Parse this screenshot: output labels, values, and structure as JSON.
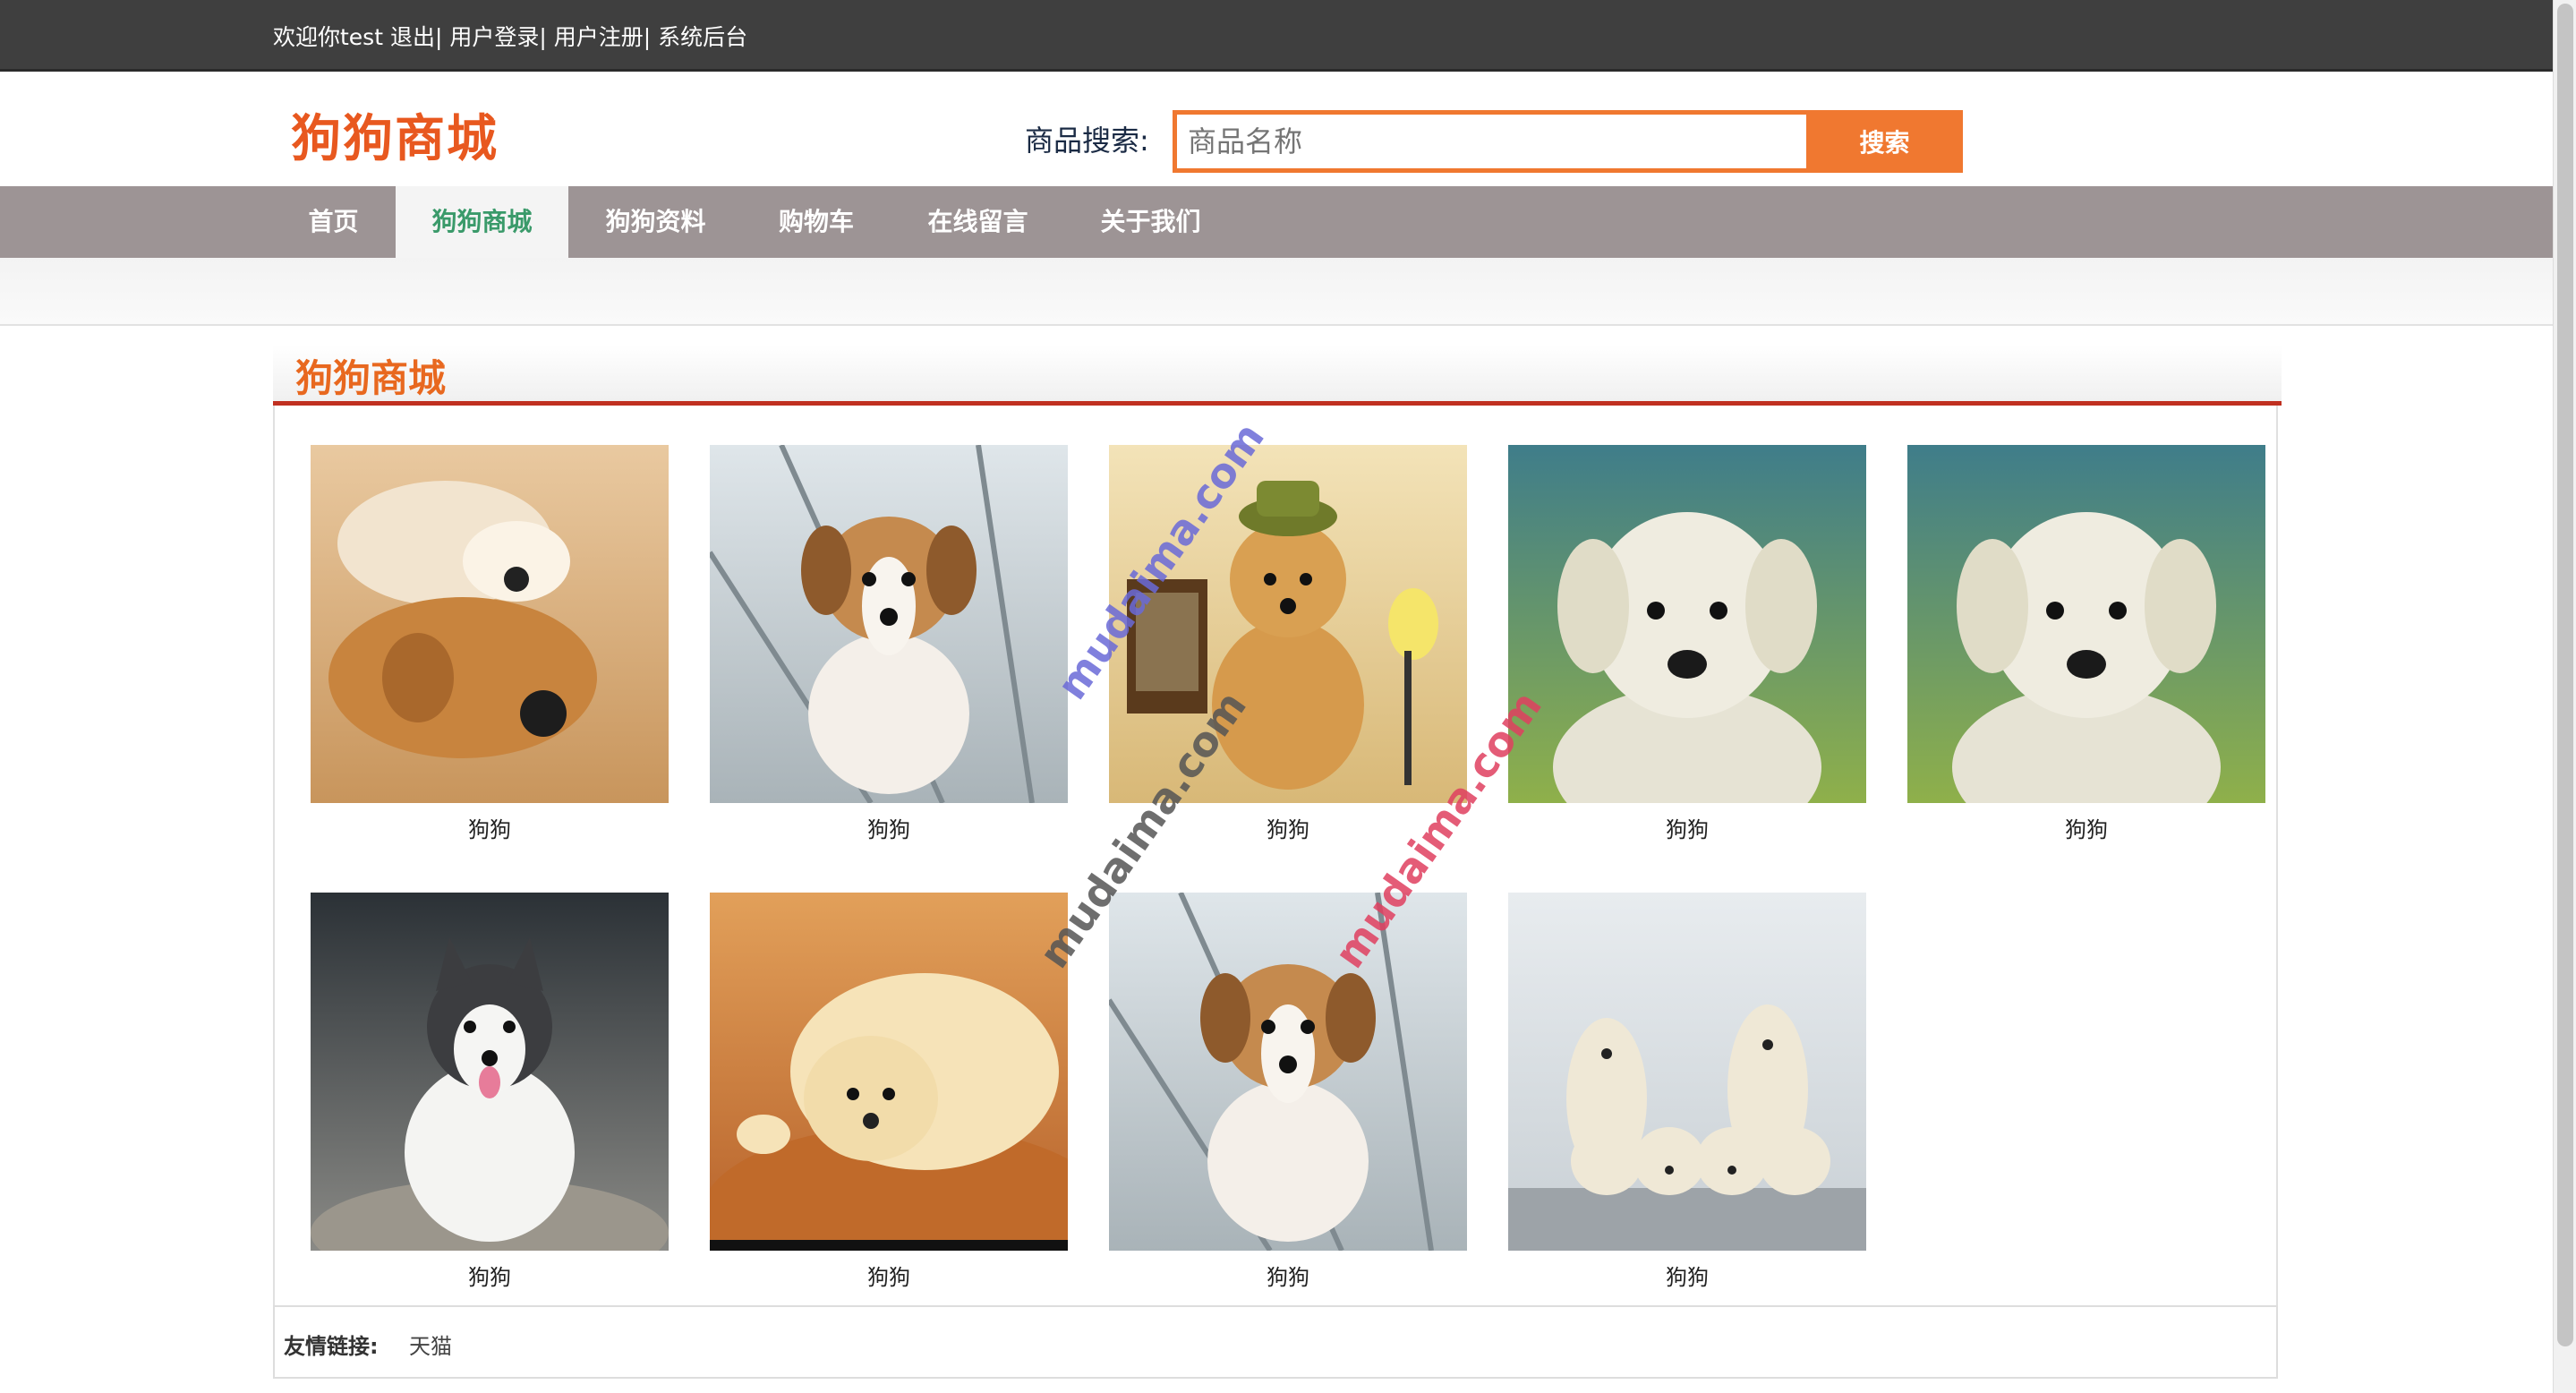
{
  "topbar": {
    "welcome": "欢迎你test",
    "logout": "退出",
    "login": "用户登录",
    "register": "用户注册",
    "admin": "系统后台"
  },
  "header": {
    "logo": "狗狗商城",
    "search_label": "商品搜索:",
    "search_placeholder": "商品名称",
    "search_button": "搜索"
  },
  "nav": {
    "items": [
      {
        "label": "首页"
      },
      {
        "label": "狗狗商城"
      },
      {
        "label": "狗狗资料"
      },
      {
        "label": "购物车"
      },
      {
        "label": "在线留言"
      },
      {
        "label": "关于我们"
      }
    ],
    "active_index": 1
  },
  "section": {
    "title": "狗狗商城"
  },
  "products": [
    {
      "name": "狗狗",
      "image": "golden-retrievers-lying"
    },
    {
      "name": "狗狗",
      "image": "corgi-puppy-on-boards"
    },
    {
      "name": "狗狗",
      "image": "golden-puppy-with-hat"
    },
    {
      "name": "狗狗",
      "image": "white-labrador-puppy"
    },
    {
      "name": "狗狗",
      "image": "white-labrador-puppy"
    },
    {
      "name": "狗狗",
      "image": "husky-puppy"
    },
    {
      "name": "狗狗",
      "image": "fluffy-puppy-on-wood"
    },
    {
      "name": "狗狗",
      "image": "corgi-puppy-on-boards"
    },
    {
      "name": "狗狗",
      "image": "group-of-lab-puppies"
    }
  ],
  "watermark": {
    "text": "mudaima.com"
  },
  "footer": {
    "label": "友情链接:",
    "link": "天猫"
  },
  "colors": {
    "accent": "#f07830",
    "logo": "#e8581f",
    "nav_bg": "#9d9495",
    "topbar_bg": "#3f3f3f",
    "active_nav_text": "#3a9a6a",
    "section_underline": "#c03020"
  }
}
